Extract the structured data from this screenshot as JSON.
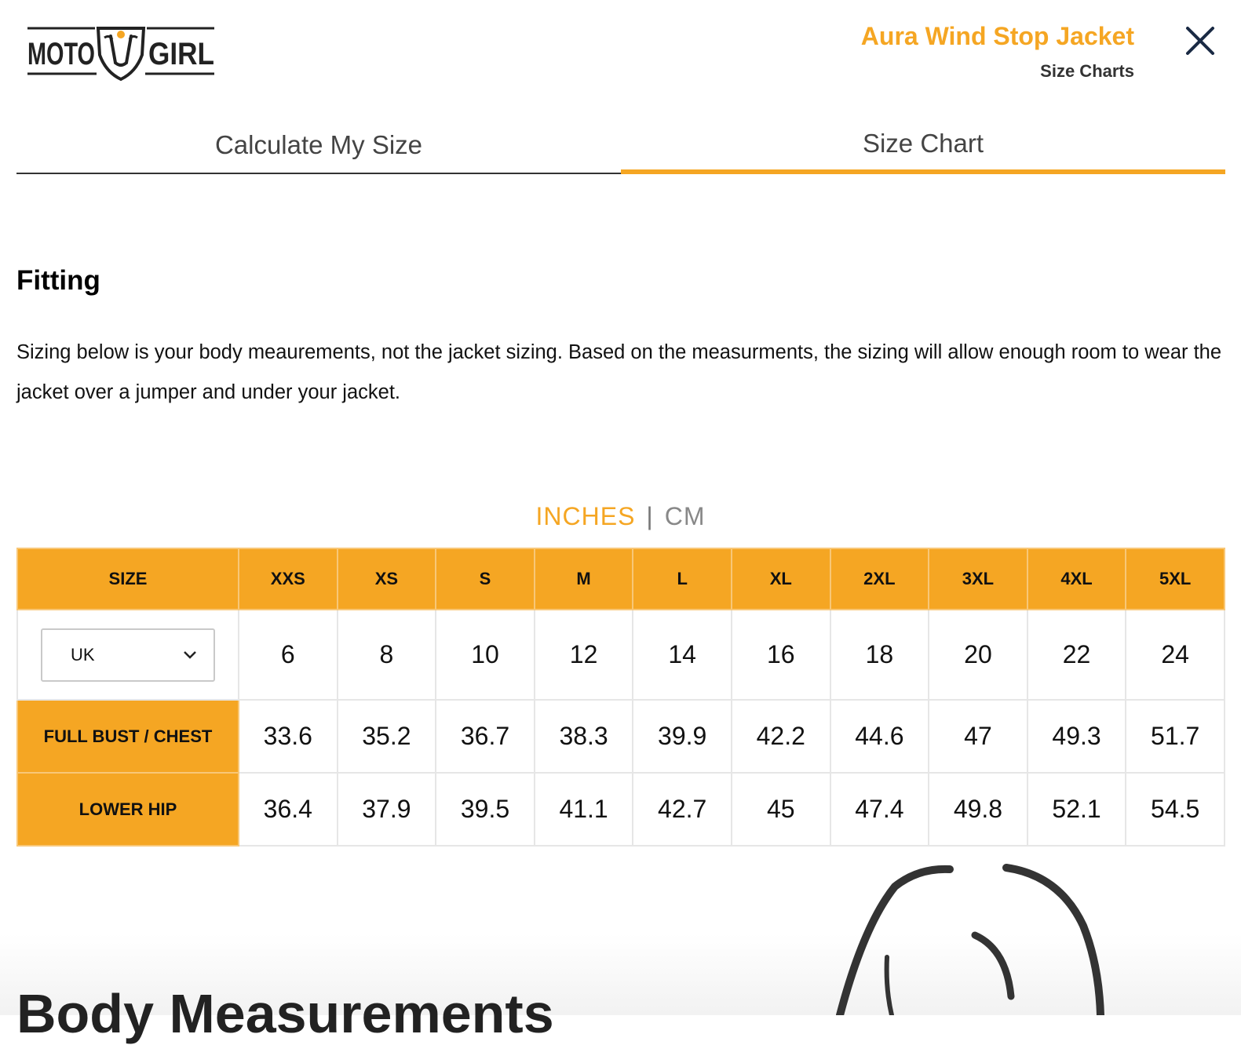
{
  "header": {
    "logo": {
      "left_text": "MOTO",
      "right_text": "GIRL",
      "icon": "motogirl-shield-logo"
    },
    "product_title": "Aura Wind Stop Jacket",
    "subtitle": "Size Charts",
    "close_icon": "close-icon"
  },
  "tabs": [
    {
      "label": "Calculate My Size",
      "active": false
    },
    {
      "label": "Size Chart",
      "active": true
    }
  ],
  "fitting": {
    "heading": "Fitting",
    "description": "Sizing below is your body meaurements, not the jacket sizing. Based on the measurments, the sizing will allow enough room to wear the jacket over a jumper and under your jacket."
  },
  "units": {
    "inches": "INCHES",
    "separator": "|",
    "cm": "CM",
    "selected": "INCHES"
  },
  "table": {
    "size_label": "SIZE",
    "sizes": [
      "XXS",
      "XS",
      "S",
      "M",
      "L",
      "XL",
      "2XL",
      "3XL",
      "4XL",
      "5XL"
    ],
    "region_select": {
      "value": "UK",
      "icon": "chevron-down-icon"
    },
    "region_values": [
      "6",
      "8",
      "10",
      "12",
      "14",
      "16",
      "18",
      "20",
      "22",
      "24"
    ],
    "bust_label": "FULL BUST / CHEST",
    "bust_values": [
      "33.6",
      "35.2",
      "36.7",
      "38.3",
      "39.9",
      "42.2",
      "44.6",
      "47",
      "49.3",
      "51.7"
    ],
    "hip_label": "LOWER HIP",
    "hip_values": [
      "36.4",
      "37.9",
      "39.5",
      "41.1",
      "42.7",
      "45",
      "47.4",
      "49.8",
      "52.1",
      "54.5"
    ]
  },
  "body": {
    "title": "Body Measurements",
    "figure_icon": "body-outline-illustration"
  },
  "colors": {
    "accent": "#f5a623",
    "text": "#111111",
    "border": "#e6e6e6"
  }
}
